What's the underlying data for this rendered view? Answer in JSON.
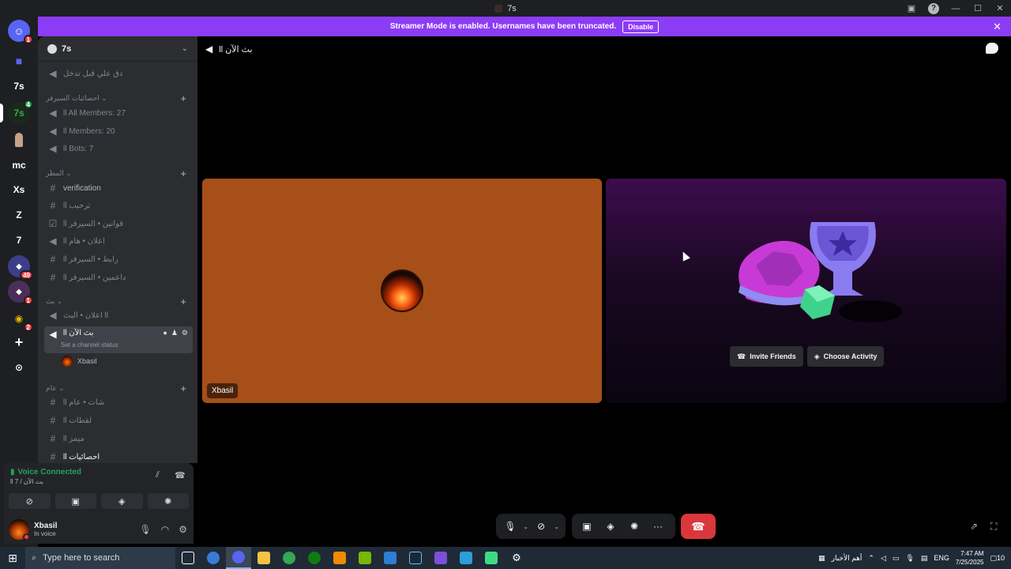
{
  "window": {
    "title": "7s"
  },
  "banner": {
    "text": "Streamer Mode is enabled. Usernames have been truncated.",
    "button": "Disable"
  },
  "rail": {
    "items": [
      {
        "label": "",
        "badge": "1",
        "icon": "discord-home-icon",
        "color": "#5865f2"
      },
      {
        "label": "",
        "badge": "",
        "icon": "folder-icon",
        "color": "#5865f2"
      },
      {
        "label": "7s",
        "badge": "",
        "icon": "",
        "color": "#2b2d31"
      },
      {
        "label": "7s",
        "badge": "4",
        "icon": "",
        "color": "#1a2a1a"
      },
      {
        "label": "",
        "badge": "",
        "icon": "avatar-icon",
        "color": "#2b2d31"
      },
      {
        "label": "mc",
        "badge": "",
        "icon": "",
        "color": "#2b2d31"
      },
      {
        "label": "Xs",
        "badge": "",
        "icon": "",
        "color": "#2b2d31"
      },
      {
        "label": "Z",
        "badge": "",
        "icon": "",
        "color": "#2b2d31"
      },
      {
        "label": "7",
        "badge": "",
        "icon": "",
        "color": "#2b2d31"
      },
      {
        "label": "",
        "badge": "49",
        "icon": "group-icon",
        "color": "#3b3f8a"
      },
      {
        "label": "",
        "badge": "1",
        "icon": "group-icon",
        "color": "#4a2f5a"
      },
      {
        "label": "",
        "badge": "2",
        "icon": "eye-icon",
        "color": "#2b2d31"
      }
    ],
    "add": "+",
    "explore": "compass-icon"
  },
  "sidebar": {
    "server_name": "7s",
    "top_channel": "دق علي قبل تدخل",
    "categories": [
      {
        "name": "احصائيات السيرفر ⌄"
      },
      {
        "name": "المطر ⌄"
      },
      {
        "name": "بث ⌄"
      },
      {
        "name": "عام ⌄"
      }
    ],
    "stats": [
      "ll All Members: 27",
      "ll Members: 20",
      "ll Bots: 7"
    ],
    "text_channels": [
      "verification",
      "ll ترحيب",
      "ll قوانين • السيرفر",
      "ll اعلان • هام",
      "ll رابط • السيرفر",
      "ll داعمين • السيرفر"
    ],
    "stream_channels": [
      "اعلان • البث ll"
    ],
    "active_channel": {
      "name": "ll بث الآن",
      "status": "Set a channel status",
      "user": "Xbasil"
    },
    "general_channels": [
      "ll شات • عام",
      "ll لقطات",
      "ll ميمز",
      "ll احصائيات"
    ]
  },
  "voice_panel": {
    "status": "Voice Connected",
    "channel": "ll بث الآن / 7"
  },
  "user": {
    "name": "Xbasil",
    "state": "In voice"
  },
  "call": {
    "channel_title": "ll بث الآن",
    "participant_label": "Xbasil",
    "invite_label": "Invite Friends",
    "activity_label": "Choose Activity"
  },
  "taskbar": {
    "search_placeholder": "Type here to search",
    "news": "أهم الأخبار",
    "lang": "ENG",
    "time": "7:47 AM",
    "date": "7/25/2025",
    "notif_count": "10"
  },
  "colors": {
    "accent": "#8c3cf5",
    "user_tile": "#a64f18",
    "connected": "#23a55a",
    "end_call": "#da373c"
  }
}
